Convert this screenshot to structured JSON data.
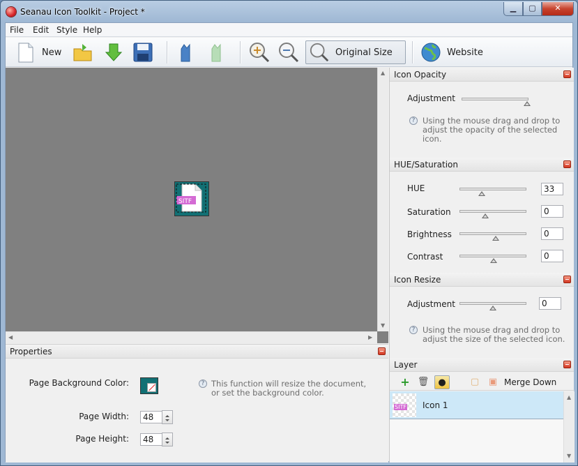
{
  "window": {
    "title": "Seanau Icon Toolkit - Project *",
    "min_glyph": "▁",
    "max_glyph": "▢",
    "close_glyph": "✕"
  },
  "menu": [
    "File",
    "Edit",
    "Style",
    "Help"
  ],
  "toolbar": {
    "new_label": "New",
    "original_size_label": "Original Size",
    "website_label": "Website"
  },
  "canvas": {
    "background": "#808080",
    "icon_tag": "SITF",
    "icon_bg": "#127074"
  },
  "properties": {
    "title": "Properties",
    "bg_color_label": "Page Background Color:",
    "width_label": "Page Width:",
    "width_value": "48",
    "height_label": "Page Height:",
    "height_value": "48",
    "help": "This function will resize the document, or set the background color."
  },
  "opacity": {
    "title": "Icon Opacity",
    "adjustment_label": "Adjustment",
    "level": 1.0,
    "help": "Using the mouse drag and drop to adjust the opacity of the selected icon."
  },
  "hue": {
    "title": "HUE/Saturation",
    "rows": [
      {
        "label": "HUE",
        "value": "33",
        "level": 0.33
      },
      {
        "label": "Saturation",
        "value": "0",
        "level": 0.38
      },
      {
        "label": "Brightness",
        "value": "0",
        "level": 0.54
      },
      {
        "label": "Contrast",
        "value": "0",
        "level": 0.51
      }
    ]
  },
  "resize": {
    "title": "Icon Resize",
    "adjustment_label": "Adjustment",
    "value": "0",
    "level": 0.5,
    "help": "Using the mouse drag and drop to adjust the size of the selected icon."
  },
  "layer": {
    "title": "Layer",
    "merge_down_label": "Merge Down",
    "items": [
      {
        "name": "Icon 1",
        "tag": "SITF"
      }
    ]
  },
  "icons": {
    "new": "new-document-icon",
    "open": "open-folder-icon",
    "import": "import-arrow-icon",
    "save": "floppy-save-icon",
    "undo": "undo-icon",
    "redo": "redo-icon",
    "zoom_in": "zoom-in-icon",
    "zoom_out": "zoom-out-icon",
    "original": "magnifier-icon",
    "website": "globe-icon",
    "help": "help-icon"
  }
}
